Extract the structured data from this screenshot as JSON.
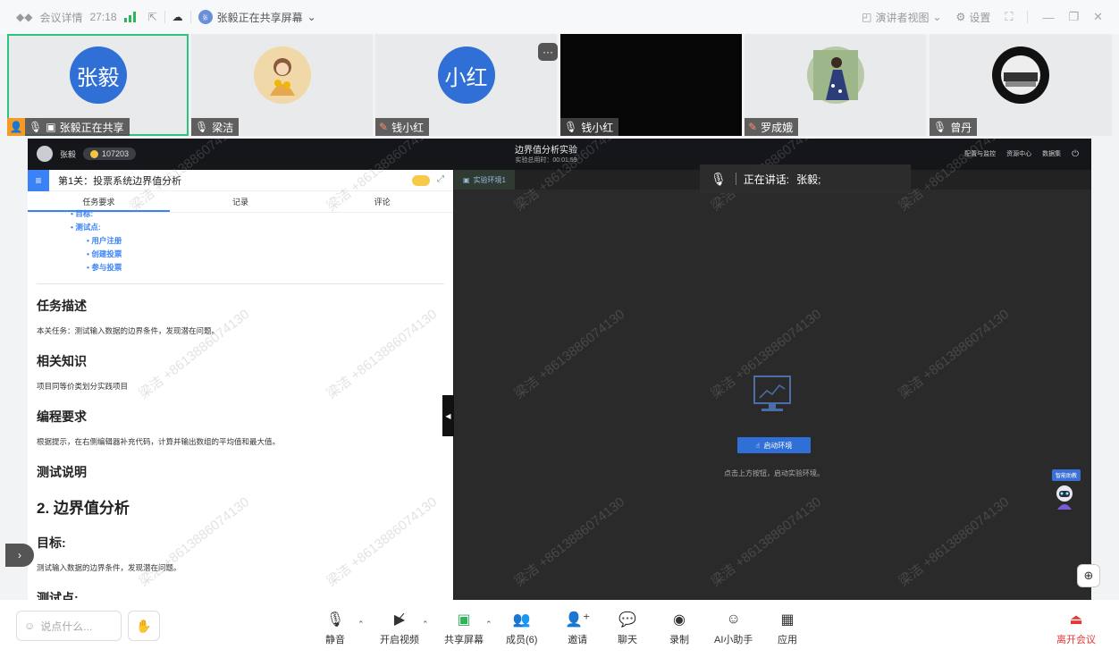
{
  "titlebar": {
    "meeting_info": "会议详情",
    "timer": "27:18",
    "sharing_label": "张毅正在共享屏幕",
    "presenter_view": "演讲者视图",
    "settings": "设置"
  },
  "tiles": [
    {
      "name": "张毅",
      "avatar_text": "张毅",
      "tag": "张毅正在共享"
    },
    {
      "name": "梁洁",
      "tag": "梁洁"
    },
    {
      "name": "钱小红",
      "avatar_text": "小红",
      "tag": "钱小红"
    },
    {
      "name": "钱小红",
      "tag": "钱小红"
    },
    {
      "name": "罗成娥",
      "tag": "罗成娥"
    },
    {
      "name": "曾丹",
      "tag": "曾丹"
    }
  ],
  "shared": {
    "user": "张毅",
    "score": "107203",
    "experiment_title": "边界值分析实验",
    "experiment_time": "实验总用时：00:01:59",
    "top_links": [
      "配置与监控",
      "资源中心",
      "数据集"
    ],
    "left_title": "第1关：投票系统边界值分析",
    "tabs": [
      "任务要求",
      "记录",
      "评论"
    ],
    "bullets_top": [
      "目标:",
      "测试点:"
    ],
    "bullets_sub": [
      "用户注册",
      "创建投票",
      "参与投票"
    ],
    "sec1_title": "任务描述",
    "sec1_text": "本关任务：测试输入数据的边界条件，发现潜在问题。",
    "sec2_title": "相关知识",
    "sec2_text": "项目同等价类划分实践项目",
    "sec3_title": "编程要求",
    "sec3_text": "根据提示，在右侧编辑器补充代码，计算并输出数组的平均值和最大值。",
    "sec4_title": "测试说明",
    "big_title": "2. 边界值分析",
    "goal_title": "目标:",
    "goal_text": "测试输入数据的边界条件，发现潜在问题。",
    "test_title": "测试点:",
    "env_tab": "实验环境1",
    "start_button": "启动环境",
    "start_hint": "点击上方按钮，启动实验环境。",
    "assistant_tag": "智能助教",
    "watermark": "梁洁 +8613886074130"
  },
  "speaking": {
    "label": "正在讲话:",
    "name": "张毅;"
  },
  "toolbar": {
    "chat_placeholder": "说点什么...",
    "mute": "静音",
    "video": "开启视频",
    "share": "共享屏幕",
    "members": "成员(6)",
    "invite": "邀请",
    "chat": "聊天",
    "record": "录制",
    "ai": "AI小助手",
    "apps": "应用",
    "leave": "离开会议"
  },
  "colors": {
    "accent": "#3b82f6",
    "active_border": "#2ec27e",
    "leave": "#e53935",
    "signal": "#2fb457"
  }
}
